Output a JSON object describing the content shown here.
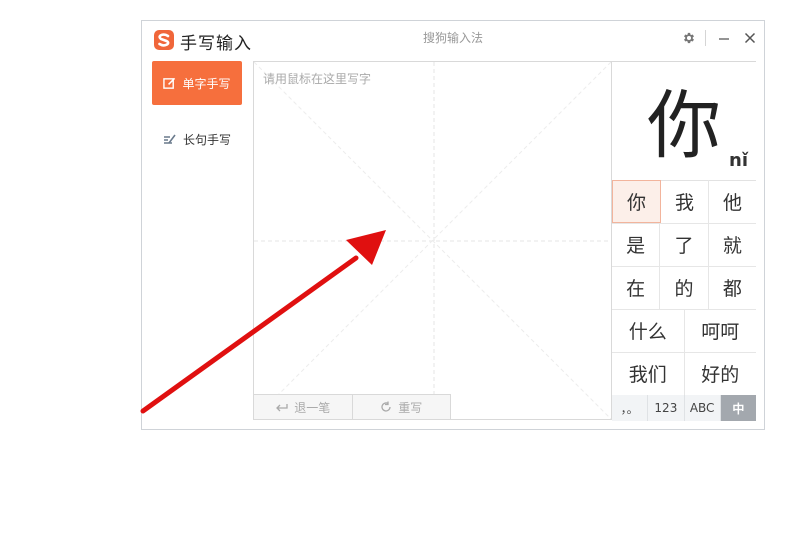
{
  "window": {
    "app_title": "手写输入",
    "ime_name": "搜狗输入法"
  },
  "sidebar": {
    "modes": [
      {
        "label": "单字手写",
        "icon": "edit-icon",
        "active": true
      },
      {
        "label": "长句手写",
        "icon": "handwriting-lines-icon",
        "active": false
      }
    ]
  },
  "canvas": {
    "placeholder": "请用鼠标在这里写字",
    "actions": [
      {
        "label": "退一笔",
        "icon": "undo-arrow-icon"
      },
      {
        "label": "重写",
        "icon": "rewrite-icon"
      }
    ]
  },
  "candidates": {
    "preview_char": "你",
    "preview_pinyin": "nǐ",
    "rows": [
      [
        "你",
        "我",
        "他"
      ],
      [
        "是",
        "了",
        "就"
      ],
      [
        "在",
        "的",
        "都"
      ],
      [
        "什么",
        "呵呵"
      ],
      [
        "我们",
        "好的"
      ]
    ],
    "selected": "你",
    "keyboard_modes": [
      "，。",
      "123",
      "ABC",
      "中"
    ],
    "active_keyboard": "中"
  },
  "colors": {
    "accent": "#f66f3d",
    "annotation_arrow": "#e01010"
  }
}
